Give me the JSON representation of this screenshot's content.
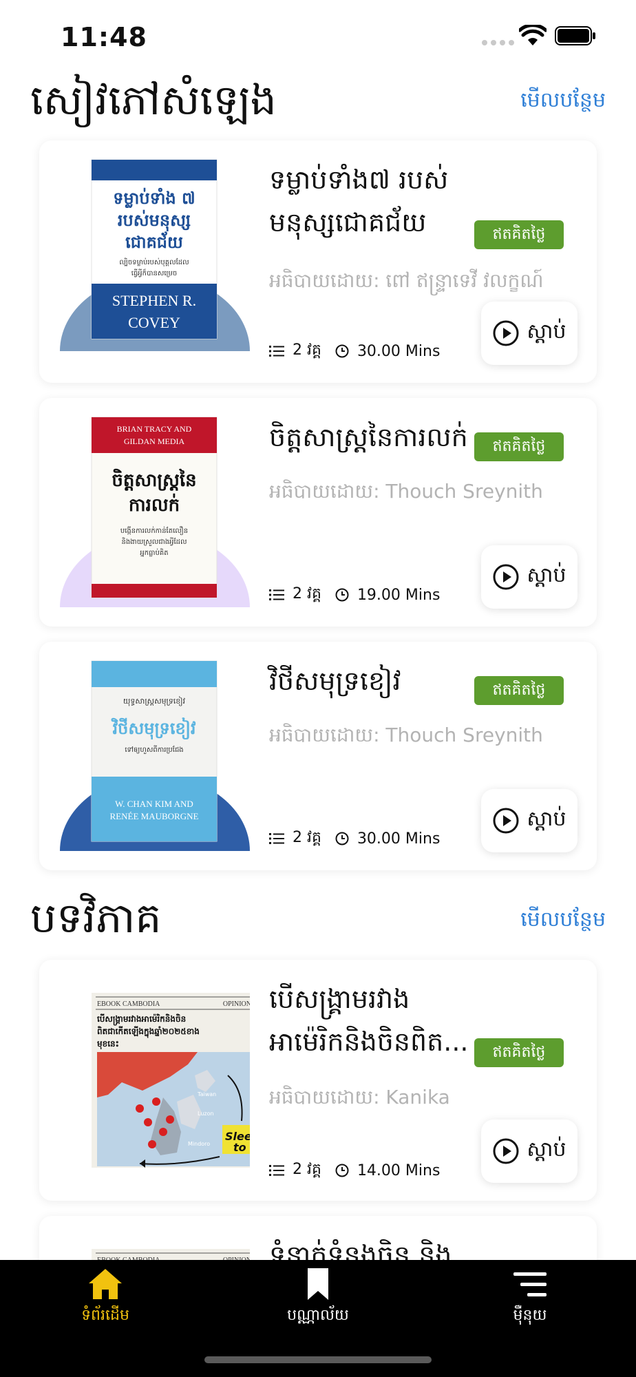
{
  "status": {
    "time": "11:48"
  },
  "sections": {
    "audiobooks": {
      "title": "សៀវភៅសំឡេង",
      "see_more": "មើលបន្ថែម"
    },
    "articles": {
      "title": "បទវិភាគ",
      "see_more": "មើលបន្ថែម"
    }
  },
  "cards": [
    {
      "title": "ទម្លាប់ទាំង៧ របស់មនុស្សជោគជ័យ",
      "badge": "ឥតគិតថ្លៃ",
      "narrator": "អធិបាយដោយ: ពៅ ឥន្ទ្រាទេវី វលក្ខណ៍",
      "episodes": "2 វគ្គ",
      "duration": "30.00 Mins",
      "listen": "ស្តាប់",
      "cover": {
        "title_lines": [
          "ទម្លាប់ទាំង ៧",
          "របស់មនុស្ស",
          "ជោគជ័យ"
        ],
        "subtitle_lines": [
          "ល្បិចទម្លាប់របស់បុគ្គលដែល",
          "ធ្វើអ្វីក៏បានសម្រេច"
        ],
        "author_lines": [
          "STEPHEN R.",
          "COVEY"
        ],
        "accent": "#1e4f96",
        "arch_color": "#7b9bbf"
      }
    },
    {
      "title": "ចិត្តសាស្រ្តនៃការលក់",
      "badge": "ឥតគិតថ្លៃ",
      "narrator": "អធិបាយដោយ: Thouch Sreynith",
      "episodes": "2 វគ្គ",
      "duration": "19.00 Mins",
      "listen": "ស្តាប់",
      "cover": {
        "header_lines": [
          "BRIAN TRACY AND",
          "GILDAN MEDIA"
        ],
        "title_lines": [
          "ចិត្តសាស្ត្រនៃ",
          "ការលក់"
        ],
        "subtitle_lines": [
          "បង្កើនការលក់កាន់តែលឿន",
          "និងងាយស្រួលជាងអ្វីដែល",
          "អ្នកធ្លាប់គិត"
        ],
        "accent": "#c0162a",
        "arch_color": "#e6d9fb"
      }
    },
    {
      "title": "វិថីសមុទ្រខៀវ",
      "badge": "ឥតគិតថ្លៃ",
      "narrator": "អធិបាយដោយ: Thouch Sreynith",
      "episodes": "2 វគ្គ",
      "duration": "30.00 Mins",
      "listen": "ស្តាប់",
      "cover": {
        "header_lines": [
          "យុទ្ធសាស្ត្រសមុទ្រខៀវ"
        ],
        "title_lines": [
          "វិថីសមុទ្រខៀវ"
        ],
        "subtitle_lines": [
          "ទៅឲ្យហួសពីការប្រជែង"
        ],
        "author_lines": [
          "W. CHAN KIM AND",
          "RENÉE MAUBORGNE"
        ],
        "accent": "#5bb4e0",
        "arch_color": "#2f5ea7"
      }
    },
    {
      "title": "បើសង្គ្រាមរវាងអាម៉េរិកនិងចិនពិត...",
      "badge": "ឥតគិតថ្លៃ",
      "narrator": "អធិបាយដោយ: Kanika",
      "episodes": "2 វគ្គ",
      "duration": "14.00 Mins",
      "listen": "ស្តាប់",
      "cover": {
        "brand": "EBOOK CAMBODIA",
        "tag": "OPINION",
        "title_lines": [
          "បើសង្គ្រាមរវាងអាម៉េរិកនិងចិន",
          "ពិតជាកើតឡើងក្នុងឆ្នាំ២០២៥ខាង",
          "មុខនេះ"
        ],
        "map_labels": [
          "Taiwan",
          "Luzon",
          "Mindoro",
          "Slee",
          "to"
        ]
      }
    },
    {
      "title": "ទំនាក់ទំនងចិន និង",
      "cover": {
        "brand": "EBOOK CAMBODIA",
        "tag": "OPINION"
      }
    }
  ],
  "tabs": [
    {
      "label": "ទំព័រដើម",
      "icon": "home-icon"
    },
    {
      "label": "បណ្ណាល័យ",
      "icon": "bookmark-icon"
    },
    {
      "label": "ម៉ឺនុយ",
      "icon": "menu-icon"
    }
  ],
  "colors": {
    "accent_link": "#2f7fd6",
    "badge_green": "#5d9d2e",
    "tab_active": "#f1c20f"
  }
}
